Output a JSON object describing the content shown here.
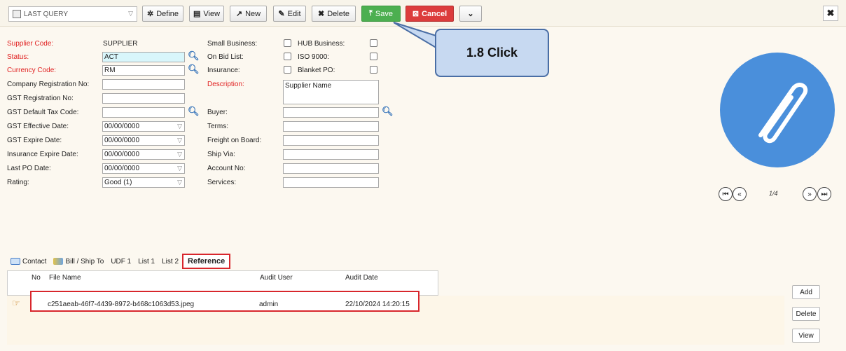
{
  "toolbar": {
    "query_value": "LAST QUERY",
    "define": "Define",
    "view": "View",
    "new": "New",
    "edit": "Edit",
    "delete": "Delete",
    "save": "Save",
    "cancel": "Cancel",
    "more_icon": "chevron-down-icon",
    "close": "✖"
  },
  "callout": {
    "text": "1.8 Click"
  },
  "form": {
    "supplier_code_label": "Supplier Code:",
    "supplier_code_value": "SUPPLIER",
    "status_label": "Status:",
    "status_value": "ACT",
    "currency_label": "Currency Code:",
    "currency_value": "RM",
    "company_reg_label": "Company Registration No:",
    "gst_reg_label": "GST Registration No:",
    "gst_tax_label": "GST Default Tax Code:",
    "gst_eff_label": "GST Effective Date:",
    "gst_eff_value": "00/00/0000",
    "gst_exp_label": "GST Expire Date:",
    "gst_exp_value": "00/00/0000",
    "ins_exp_label": "Insurance Expire Date:",
    "ins_exp_value": "00/00/0000",
    "last_po_label": "Last PO Date:",
    "last_po_value": "00/00/0000",
    "rating_label": "Rating:",
    "rating_value": "Good (1)",
    "small_business_label": "Small Business:",
    "hub_business_label": "HUB Business:",
    "on_bid_label": "On Bid List:",
    "iso_label": "ISO 9000:",
    "insurance_label": "Insurance:",
    "blanket_po_label": "Blanket PO:",
    "description_label": "Description:",
    "description_value": "Supplier Name",
    "buyer_label": "Buyer:",
    "terms_label": "Terms:",
    "fob_label": "Freight on Board:",
    "ship_via_label": "Ship Via:",
    "account_label": "Account No:",
    "services_label": "Services:"
  },
  "image_panel": {
    "counter": "1/4",
    "icon": "paperclip-icon"
  },
  "tabs": [
    {
      "label": "Contact"
    },
    {
      "label": "Bill / Ship To"
    },
    {
      "label": "UDF 1"
    },
    {
      "label": "List 1"
    },
    {
      "label": "List 2"
    },
    {
      "label": "Reference"
    }
  ],
  "grid": {
    "headers": {
      "no": "No",
      "file": "File Name",
      "user": "Audit User",
      "date": "Audit Date"
    },
    "rows": [
      {
        "file": "c251aeab-46f7-4439-8972-b468c1063d53.jpeg",
        "user": "admin",
        "date": "22/10/2024 14:20:15"
      }
    ]
  },
  "side_buttons": {
    "add": "Add",
    "delete": "Delete",
    "view": "View"
  },
  "colors": {
    "save": "#4caf50",
    "cancel": "#dc3c3c",
    "accent_blue": "#4a8fdb",
    "highlight_red": "#d8262c"
  }
}
